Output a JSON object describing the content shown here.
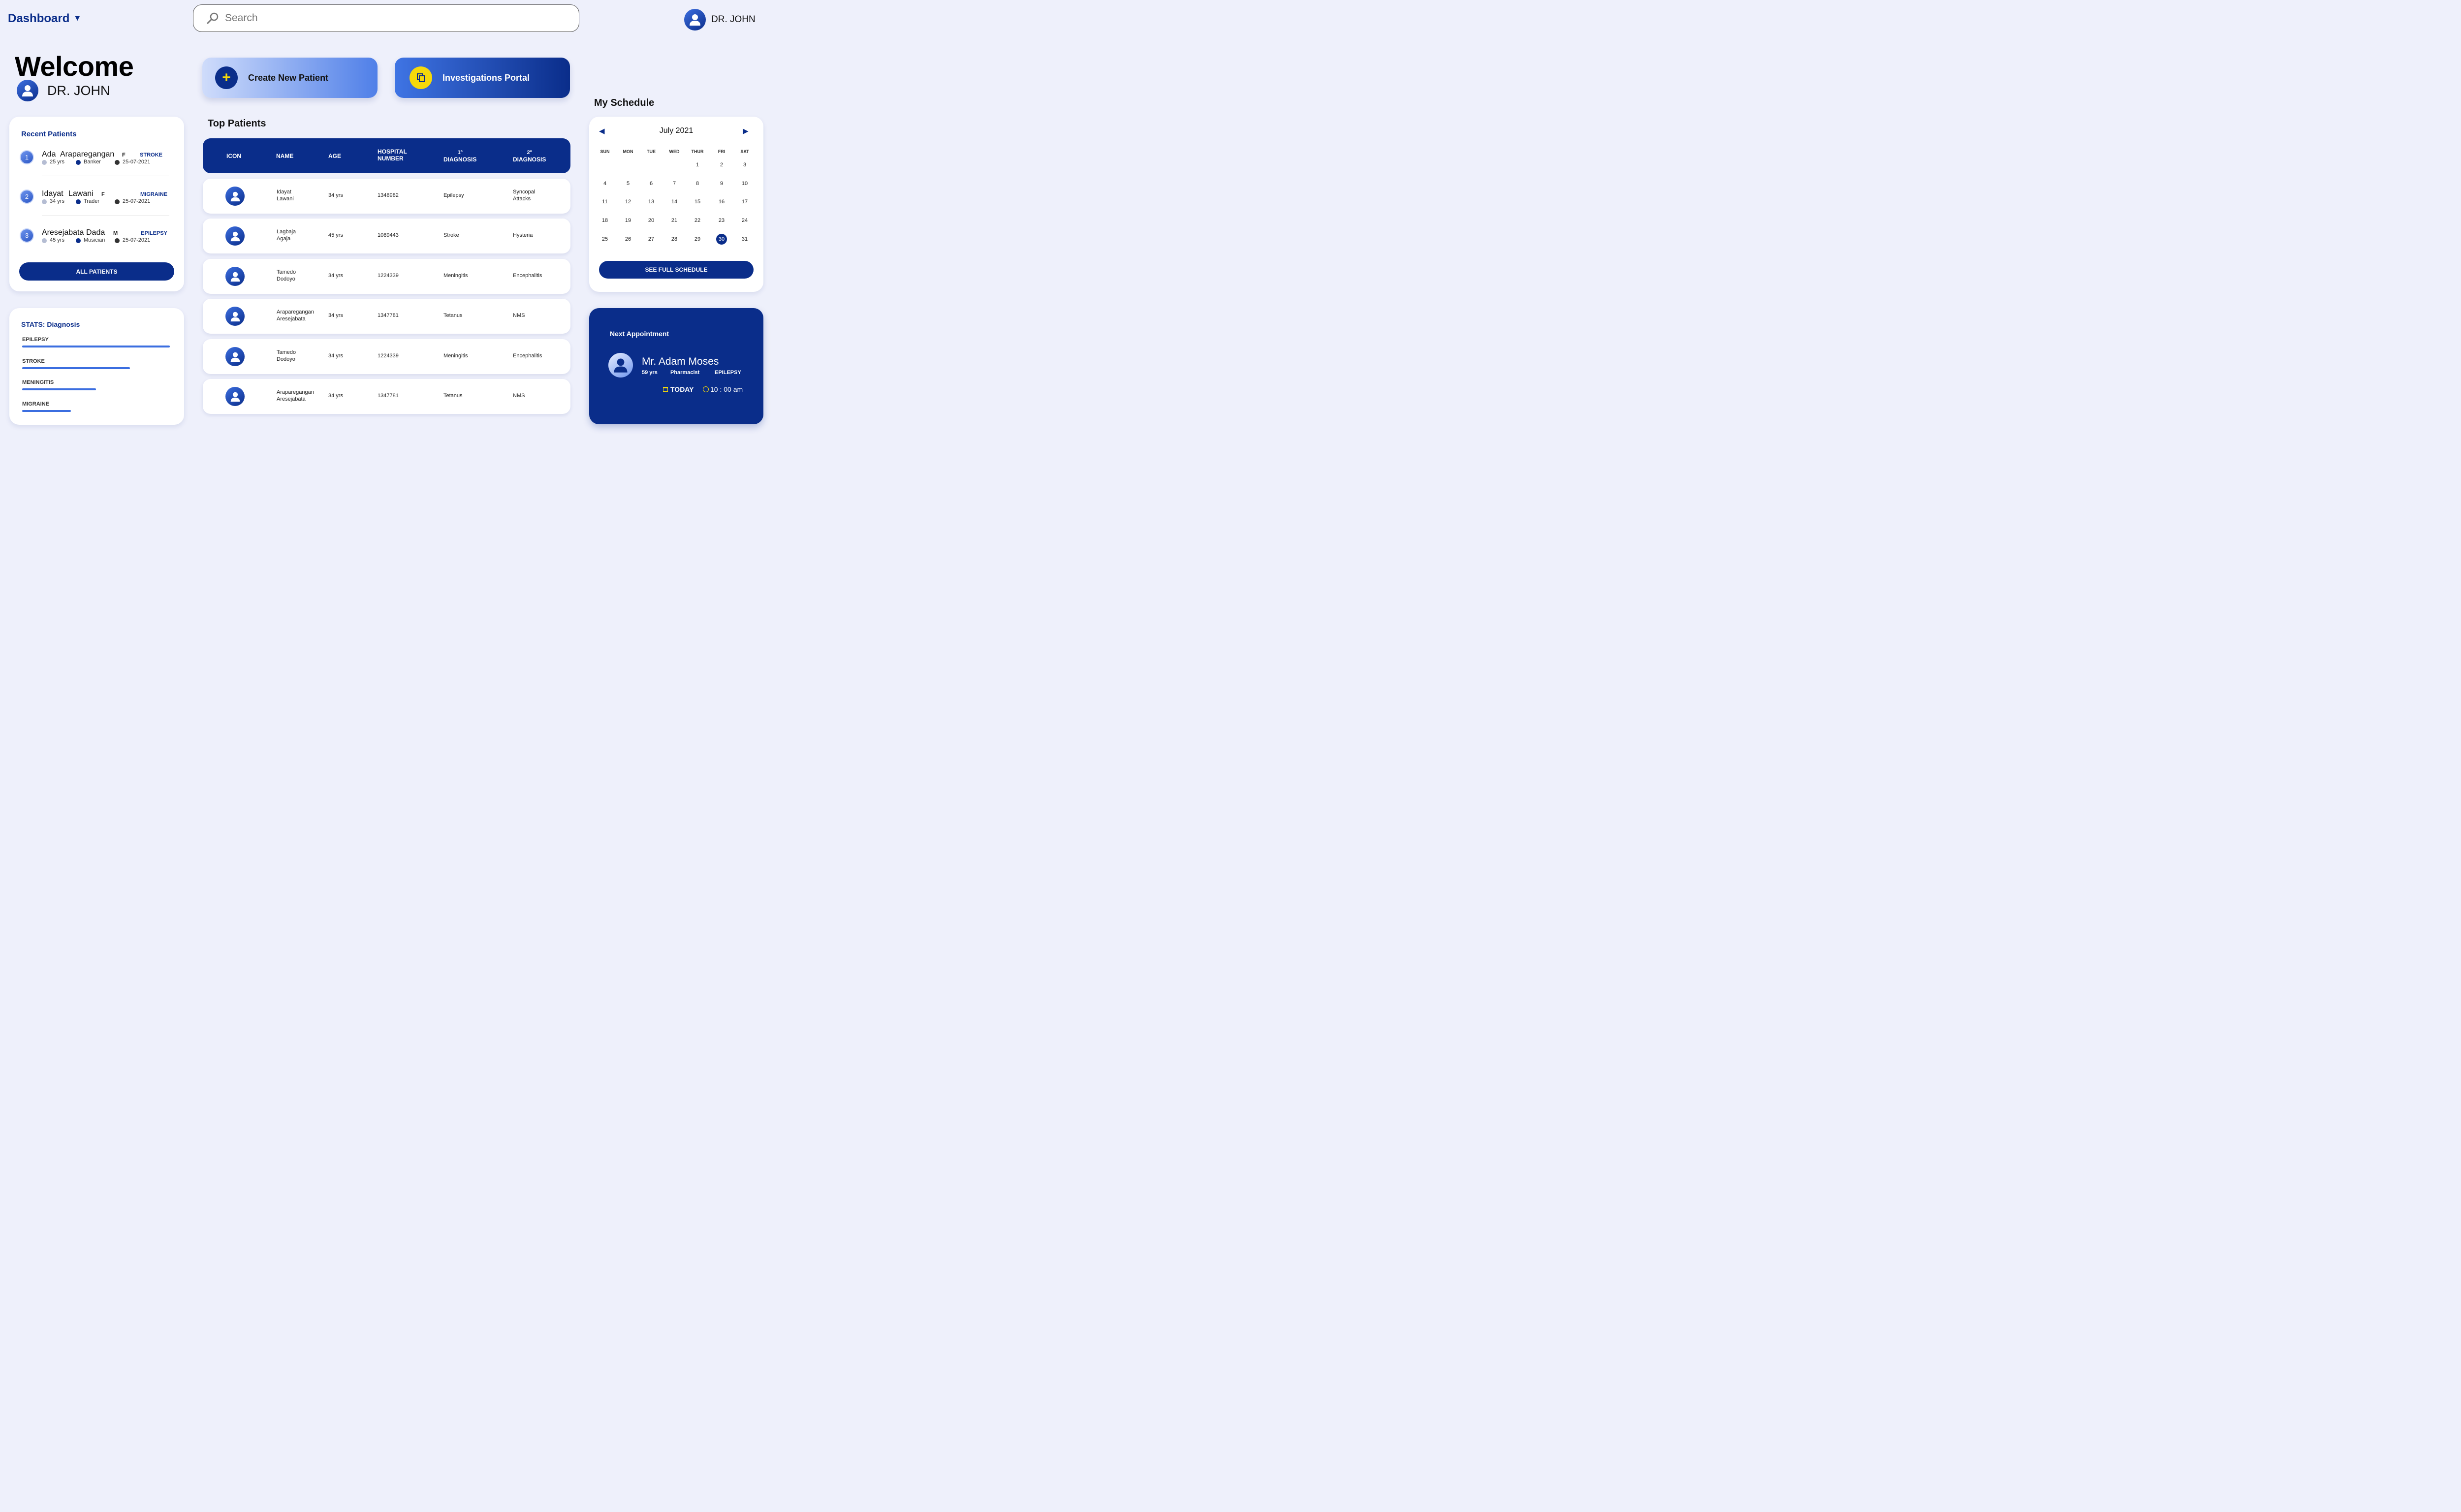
{
  "header": {
    "title": "Dashboard",
    "search_placeholder": "Search",
    "user_name": "DR. JOHN"
  },
  "welcome": {
    "heading": "Welcome",
    "name": "DR. JOHN"
  },
  "actions": {
    "create_patient": "Create New Patient",
    "investigations": "Investigations Portal"
  },
  "recent_patients": {
    "title": "Recent Patients",
    "items": [
      {
        "num": "1",
        "first": "Ada",
        "last": "Araparegangan",
        "sex": "F",
        "diagnosis": "STROKE",
        "age": "25 yrs",
        "job": "Banker",
        "date": "25-07-2021"
      },
      {
        "num": "2",
        "first": "Idayat",
        "last": "Lawani",
        "sex": "F",
        "diagnosis": "MIGRAINE",
        "age": "34 yrs",
        "job": "Trader",
        "date": "25-07-2021"
      },
      {
        "num": "3",
        "first": "Aresejabata",
        "last": "Dada",
        "sex": "M",
        "diagnosis": "EPILEPSY",
        "age": "45 yrs",
        "job": "Musician",
        "date": "25-07-2021"
      }
    ],
    "button": "ALL PATIENTS"
  },
  "stats": {
    "title": "STATS: Diagnosis",
    "items": [
      {
        "label": "EPILEPSY",
        "level": 1.0
      },
      {
        "label": "STROKE",
        "level": 0.73
      },
      {
        "label": "MENINGITIS",
        "level": 0.5
      },
      {
        "label": "MIGRAINE",
        "level": 0.33
      }
    ]
  },
  "top_patients": {
    "title": "Top Patients",
    "headers": {
      "icon": "ICON",
      "name": "NAME",
      "age": "AGE",
      "hosp1": "HOSPITAL",
      "hosp2": "NUMBER",
      "d1a": "1º",
      "d1b": "DIAGNOSIS",
      "d2a": "2º",
      "d2b": "DIAGNOSIS"
    },
    "rows": [
      {
        "name1": "Idayat",
        "name2": "Lawani",
        "age": "34 yrs",
        "hosp": "1348982",
        "d1": "Epilepsy",
        "d2a": "Syncopal",
        "d2b": "Attacks"
      },
      {
        "name1": "Lagbaja",
        "name2": "Agaja",
        "age": "45 yrs",
        "hosp": "1089443",
        "d1": "Stroke",
        "d2a": "Hysteria",
        "d2b": ""
      },
      {
        "name1": "Tamedo",
        "name2": "Dodoyo",
        "age": "34 yrs",
        "hosp": "1224339",
        "d1": "Meningitis",
        "d2a": "Encephalitis",
        "d2b": ""
      },
      {
        "name1": "Araparegangan",
        "name2": "Aresejabata",
        "age": "34 yrs",
        "hosp": "1347781",
        "d1": "Tetanus",
        "d2a": "NMS",
        "d2b": ""
      },
      {
        "name1": "Tamedo",
        "name2": "Dodoyo",
        "age": "34 yrs",
        "hosp": "1224339",
        "d1": "Meningitis",
        "d2a": "Encephalitis",
        "d2b": ""
      },
      {
        "name1": "Araparegangan",
        "name2": "Aresejabata",
        "age": "34 yrs",
        "hosp": "1347781",
        "d1": "Tetanus",
        "d2a": "NMS",
        "d2b": ""
      }
    ]
  },
  "schedule": {
    "title": "My Schedule",
    "month": "July 2021",
    "weekdays": [
      "SUN",
      "MON",
      "TUE",
      "WED",
      "THUR",
      "FRI",
      "SAT"
    ],
    "weeks": [
      [
        "",
        "",
        "",
        "",
        "1",
        "2",
        "3"
      ],
      [
        "4",
        "5",
        "6",
        "7",
        "8",
        "9",
        "10"
      ],
      [
        "11",
        "12",
        "13",
        "14",
        "15",
        "16",
        "17"
      ],
      [
        "18",
        "19",
        "20",
        "21",
        "22",
        "23",
        "24"
      ],
      [
        "25",
        "26",
        "27",
        "28",
        "29",
        "30",
        "31"
      ]
    ],
    "selected": "30",
    "button": "SEE FULL SCHEDULE"
  },
  "appointment": {
    "title": "Next Appointment",
    "name": "Mr. Adam Moses",
    "age": "59 yrs",
    "job": "Pharmacist",
    "diagnosis": "EPILEPSY",
    "day": "TODAY",
    "time": "10 : 00 am"
  },
  "colors": {
    "navy": "#0a2d8a",
    "accent_blue": "#3b6ee0",
    "yellow": "#f5d90a",
    "background": "#eef0fb"
  }
}
